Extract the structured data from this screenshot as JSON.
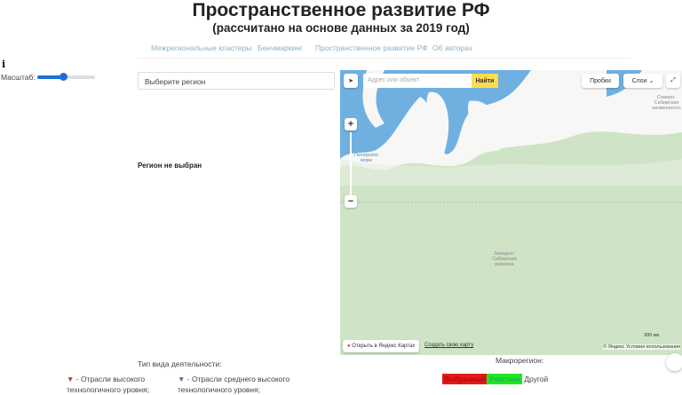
{
  "header": {
    "title": "Пространственное развитие РФ",
    "subtitle": "(рассчитано на основе данных за 2019 год)"
  },
  "nav": [
    {
      "label": "Межрегиональные кластеры"
    },
    {
      "label": "Бенчмаркинг"
    },
    {
      "label": "Пространственное развитие РФ"
    },
    {
      "label": "Об авторах"
    }
  ],
  "controls": {
    "info_icon": "i",
    "scale_label": "Масштаб:",
    "scale_value": 0.45,
    "region_placeholder": "Выберите регион",
    "no_region": "Регион не выбран"
  },
  "map": {
    "address_placeholder": "Адрес или объект",
    "find_label": "Найти",
    "traffic_label": "Пробки",
    "layers_label": "Слои",
    "sea_label": "Печорское море",
    "lowland_label": "Северо-Сибирская низменность",
    "plain_label": "Западно-Сибирская равнина",
    "open_label": "Открыть в Яндекс Картах",
    "create_label": "Создать свою карту",
    "scale_bar": "300 км",
    "terms": "© Яндекс Условия использования"
  },
  "legend": {
    "title": "Тип вида деятельности:",
    "items": [
      {
        "label": "- Отрасли высокого технологичного уровня;",
        "color": "#c0392b"
      },
      {
        "label": "- Отрасли среднего высокого технологичного уровня;",
        "color": "#4a6fa5"
      }
    ]
  },
  "macro": {
    "title": "Макрорегион:",
    "badges": [
      {
        "label": "Выбранный",
        "color": "#e01b1b"
      },
      {
        "label": "Участник",
        "color": "#22e622"
      },
      {
        "label": "Другой"
      }
    ]
  }
}
